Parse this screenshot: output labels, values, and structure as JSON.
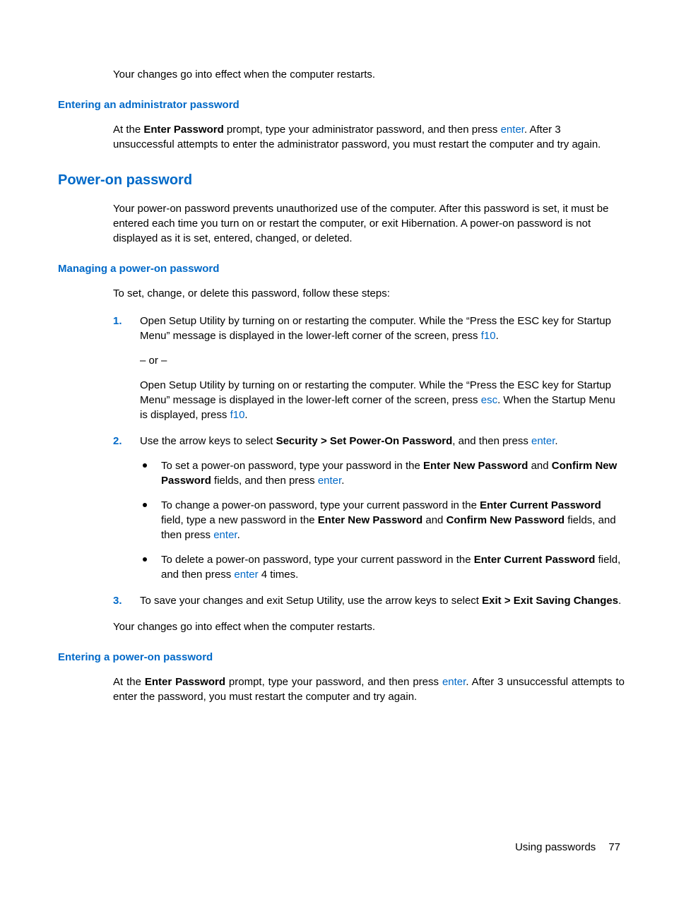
{
  "intro_restart": "Your changes go into effect when the computer restarts.",
  "admin": {
    "heading": "Entering an administrator password",
    "p1_a": "At the ",
    "p1_b": "Enter Password",
    "p1_c": " prompt, type your administrator password, and then press ",
    "p1_enter": "enter",
    "p1_d": ". After 3 unsuccessful attempts to enter the administrator password, you must restart the computer and try again."
  },
  "poweron": {
    "heading": "Power-on password",
    "intro": "Your power-on password prevents unauthorized use of the computer. After this password is set, it must be entered each time you turn on or restart the computer, or exit Hibernation. A power-on password is not displayed as it is set, entered, changed, or deleted."
  },
  "managing": {
    "heading": "Managing a power-on password",
    "intro": "To set, change, or delete this password, follow these steps:",
    "step1": {
      "num": "1.",
      "p1_a": "Open Setup Utility by turning on or restarting the computer. While the “Press the ESC key for Startup Menu” message is displayed in the lower-left corner of the screen, press ",
      "p1_f10": "f10",
      "p1_b": ".",
      "or": "– or –",
      "p2_a": "Open Setup Utility by turning on or restarting the computer. While the “Press the ESC key for Startup Menu” message is displayed in the lower-left corner of the screen, press ",
      "p2_esc": "esc",
      "p2_b": ". When the Startup Menu is displayed, press ",
      "p2_f10": "f10",
      "p2_c": "."
    },
    "step2": {
      "num": "2.",
      "p_a": "Use the arrow keys to select ",
      "p_bold": "Security > Set Power-On Password",
      "p_b": ", and then press ",
      "p_enter": "enter",
      "p_c": ".",
      "b1_a": "To set a power-on password, type your password in the ",
      "b1_bold1": "Enter New Password",
      "b1_b": " and ",
      "b1_bold2": "Confirm New Password",
      "b1_c": " fields, and then press ",
      "b1_enter": "enter",
      "b1_d": ".",
      "b2_a": "To change a power-on password, type your current password in the ",
      "b2_bold1": "Enter Current Password",
      "b2_b": " field, type a new password in the ",
      "b2_bold2": "Enter New Password",
      "b2_c": " and ",
      "b2_bold3": "Confirm New Password",
      "b2_d": " fields, and then press ",
      "b2_enter": "enter",
      "b2_e": ".",
      "b3_a": "To delete a power-on password, type your current password in the ",
      "b3_bold1": "Enter Current Password",
      "b3_b": " field, and then press ",
      "b3_enter": "enter",
      "b3_c": " 4 times."
    },
    "step3": {
      "num": "3.",
      "p_a": "To save your changes and exit Setup Utility, use the arrow keys to select ",
      "p_bold": "Exit > Exit Saving Changes",
      "p_b": "."
    },
    "closing": "Your changes go into effect when the computer restarts."
  },
  "entering": {
    "heading": "Entering a power-on password",
    "p_a": "At the ",
    "p_bold": "Enter Password",
    "p_b": " prompt, type your password, and then press ",
    "p_enter": "enter",
    "p_c": ". After 3 unsuccessful attempts to enter the password, you must restart the computer and try again."
  },
  "footer": {
    "label": "Using passwords",
    "page": "77"
  }
}
